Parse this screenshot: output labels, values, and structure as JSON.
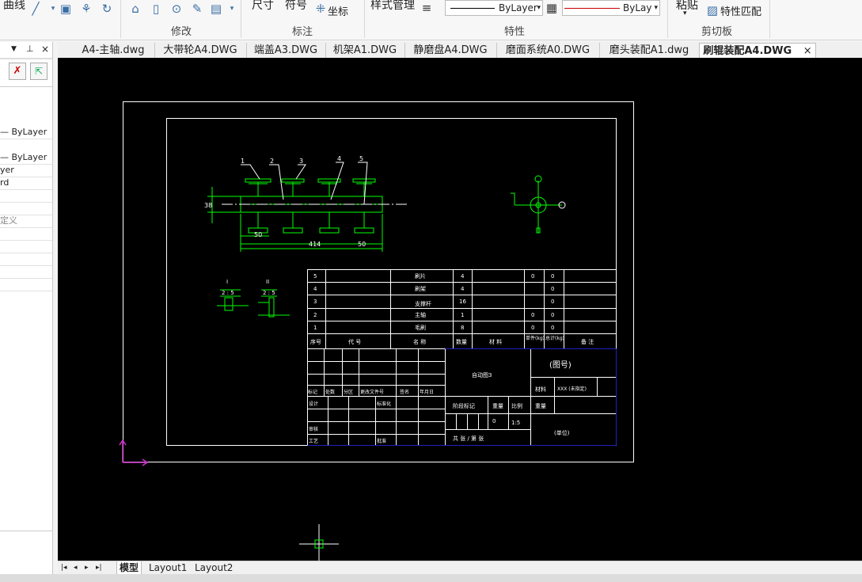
{
  "ribbon": {
    "top_left_label": "曲线",
    "dim_label": "尺寸",
    "symbol_label": "符号",
    "coord_label": "坐标",
    "style_mgr_label": "样式管理",
    "bylayer_1": "ByLayer",
    "bylayer_2": "ByLay",
    "paste_label": "粘贴",
    "match_label": "特性匹配",
    "groups": {
      "modify": "修改",
      "annotate": "标注",
      "props": "特性",
      "clipboard": "剪切板"
    }
  },
  "palette": {
    "rows": [
      "— ByLayer",
      "— ByLayer",
      "yer",
      "rd",
      "定义"
    ]
  },
  "tabs": [
    {
      "label": "A4-主轴.dwg",
      "active": false
    },
    {
      "label": "大带轮A4.DWG",
      "active": false
    },
    {
      "label": "端盖A3.DWG",
      "active": false
    },
    {
      "label": "机架A1.DWG",
      "active": false
    },
    {
      "label": "静磨盘A4.DWG",
      "active": false
    },
    {
      "label": "磨面系统A0.DWG",
      "active": false
    },
    {
      "label": "磨头装配A1.dwg",
      "active": false
    },
    {
      "label": "刷辊装配A4.DWG",
      "active": true
    }
  ],
  "tab_close": "×",
  "layouts": {
    "model": "模型",
    "layout1": "Layout1",
    "layout2": "Layout2"
  },
  "drawing": {
    "callouts": [
      "1",
      "2",
      "3",
      "4",
      "5"
    ],
    "dims": {
      "d1": "50",
      "d2": "414",
      "d3": "50",
      "dv": "38"
    },
    "section_1": "I",
    "section_2": "II",
    "scale_1": "2 : 5",
    "scale_2": "2 : 5",
    "bom_rows": [
      {
        "no": "5",
        "name": "刷片",
        "qty": "4",
        "w1": "0",
        "w2": "0"
      },
      {
        "no": "4",
        "name": "刷架",
        "qty": "4",
        "w1": "",
        "w2": "0"
      },
      {
        "no": "3",
        "name": "支撑杆",
        "qty": "16",
        "w1": "",
        "w2": "0"
      },
      {
        "no": "2",
        "name": "主轴",
        "qty": "1",
        "w1": "0",
        "w2": "0"
      },
      {
        "no": "1",
        "name": "毛刷",
        "qty": "8",
        "w1": "0",
        "w2": "0"
      }
    ],
    "bom_header": {
      "no": "序号",
      "code": "代 号",
      "name": "名 称",
      "qty": "数量",
      "mat": "材 料",
      "unit_w": "单件(kg)",
      "total_w": "总计(kg)",
      "remark": "备 注"
    },
    "title_block": {
      "drawing_name": "自动图3",
      "drawing_no": "(图号)",
      "material_label": "材料",
      "material_value": "XXX (未指定)",
      "weight_label": "重量",
      "stage_label": "阶段标记",
      "mass_label": "重量",
      "scale_label": "比例",
      "scale_value": "1:5",
      "mass_value": "0",
      "sheet_text": "共   张 / 第   张",
      "unit": "(单位)",
      "mark": "标记",
      "count": "处数",
      "zone": "分区",
      "change_doc": "更改文件号",
      "sign": "签名",
      "date": "年月日",
      "design": "设计",
      "standard": "标准化",
      "review": "审核",
      "process": "工艺",
      "approve": "批准"
    }
  }
}
